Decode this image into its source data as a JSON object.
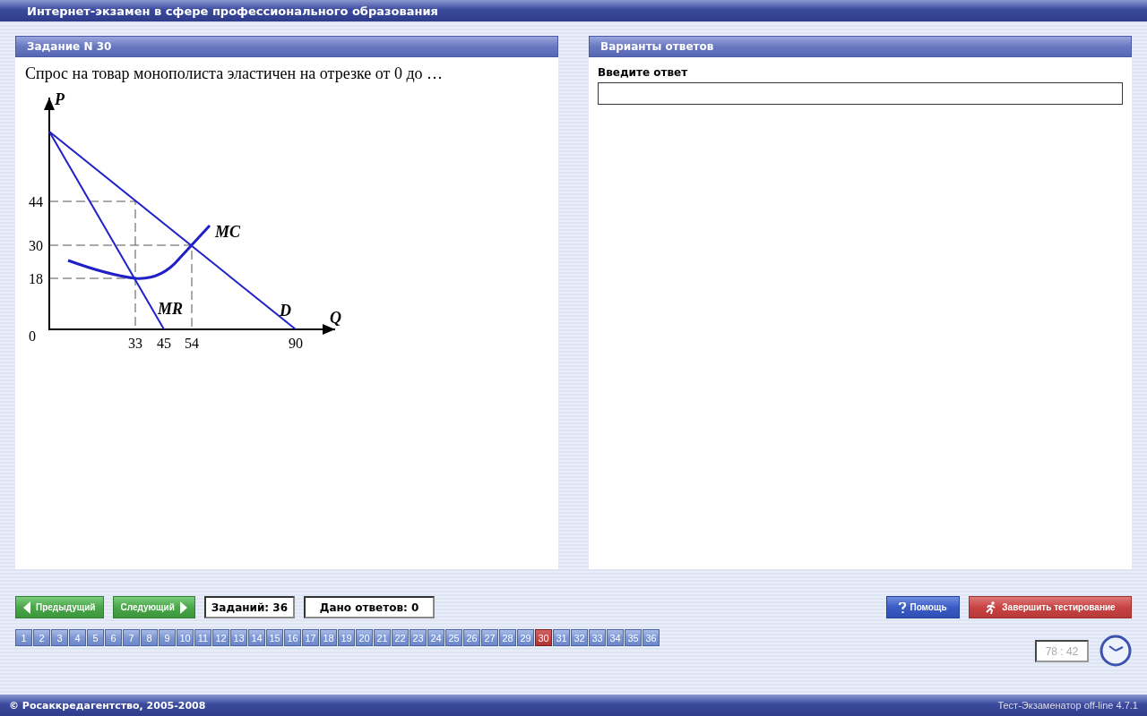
{
  "window": {
    "title": "Интернет-экзамен в сфере профессионального образования"
  },
  "task": {
    "title": "Задание N 30",
    "question": "Спрос на товар монополиста эластичен на отрезке от 0 до …",
    "figure": {
      "y_axis": "P",
      "x_axis": "Q",
      "origin": "0",
      "y_ticks": [
        "44",
        "30",
        "18"
      ],
      "x_ticks": [
        "33",
        "45",
        "54",
        "90"
      ],
      "curve_labels": [
        "MC",
        "MR",
        "D"
      ]
    }
  },
  "answers": {
    "title": "Варианты ответов",
    "prompt": "Введите ответ"
  },
  "toolbar": {
    "prev": "Предыдущий",
    "next": "Следующий",
    "tasks_count": "Заданий: 36",
    "answered": "Дано ответов: 0",
    "help": "Помощь",
    "finish": "Завершить тестирование"
  },
  "pages": [
    {
      "label": "1",
      "selected": false
    },
    {
      "label": "2",
      "selected": false
    },
    {
      "label": "3",
      "selected": false
    },
    {
      "label": "4",
      "selected": false
    },
    {
      "label": "5",
      "selected": false
    },
    {
      "label": "6",
      "selected": false
    },
    {
      "label": "7",
      "selected": false
    },
    {
      "label": "8",
      "selected": false
    },
    {
      "label": "9",
      "selected": false
    },
    {
      "label": "10",
      "selected": false
    },
    {
      "label": "11",
      "selected": false
    },
    {
      "label": "12",
      "selected": false
    },
    {
      "label": "13",
      "selected": false
    },
    {
      "label": "14",
      "selected": false
    },
    {
      "label": "15",
      "selected": false
    },
    {
      "label": "16",
      "selected": false
    },
    {
      "label": "17",
      "selected": false
    },
    {
      "label": "18",
      "selected": false
    },
    {
      "label": "19",
      "selected": false
    },
    {
      "label": "20",
      "selected": false
    },
    {
      "label": "21",
      "selected": false
    },
    {
      "label": "22",
      "selected": false
    },
    {
      "label": "23",
      "selected": false
    },
    {
      "label": "24",
      "selected": false
    },
    {
      "label": "25",
      "selected": false
    },
    {
      "label": "26",
      "selected": false
    },
    {
      "label": "27",
      "selected": false
    },
    {
      "label": "28",
      "selected": false
    },
    {
      "label": "29",
      "selected": false
    },
    {
      "label": "30",
      "selected": true
    },
    {
      "label": "31",
      "selected": false
    },
    {
      "label": "32",
      "selected": false
    },
    {
      "label": "33",
      "selected": false
    },
    {
      "label": "34",
      "selected": false
    },
    {
      "label": "35",
      "selected": false
    },
    {
      "label": "36",
      "selected": false
    }
  ],
  "timer": "78 : 42",
  "status_bar": {
    "copyright": "© Росаккредагентство, 2005-2008",
    "version": "Тест-Экзаменатор off-line 4.7.1"
  }
}
